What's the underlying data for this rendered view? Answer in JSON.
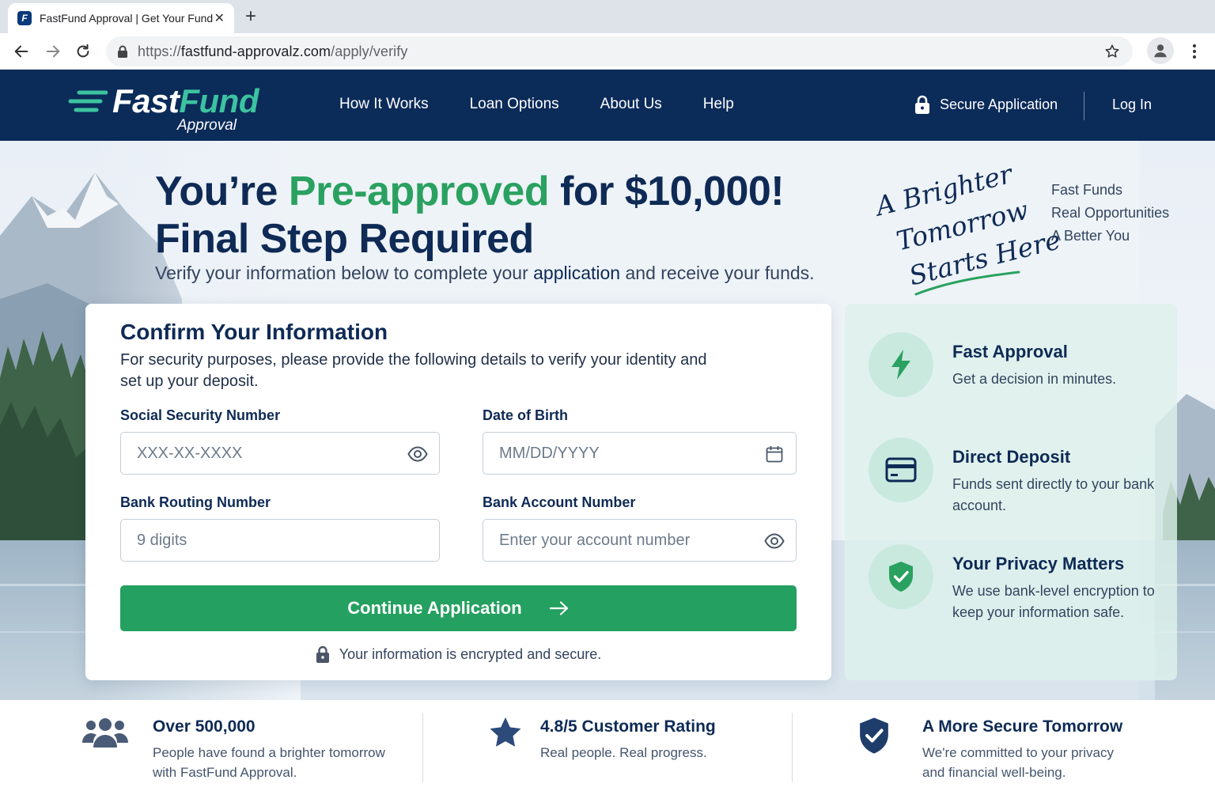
{
  "browser": {
    "tab_title": "FastFund Approval | Get Your Funds Today",
    "tab_close": "✕",
    "new_tab": "+",
    "url_scheme": "https://",
    "url_domain": "fastfund-approvalz.com",
    "url_path": "/apply/verify"
  },
  "header": {
    "logo_fast": "Fast",
    "logo_fund": "Fund",
    "logo_sub": "Approval",
    "nav": [
      "How It Works",
      "Loan Options",
      "About Us",
      "Help"
    ],
    "secure_label": "Secure Application",
    "login_label": "Log In"
  },
  "hero": {
    "headline_1": "You’re ",
    "headline_green": "Pre-approved",
    "headline_2": " for $10,000!",
    "headline_line2": "Final Step Required",
    "subhead_1": "Verify your information below to complete your ",
    "subhead_bold": "application",
    "subhead_2": " and receive your funds.",
    "script_lines": [
      "A Brighter",
      "Tomorrow",
      "Starts Here"
    ],
    "taglines": [
      "Fast Funds",
      "Real Opportunities",
      "A Better You"
    ]
  },
  "form": {
    "title": "Confirm Your Information",
    "description": "For security purposes, please provide the following details to verify your identity and set up your deposit.",
    "ssn_label": "Social Security Number",
    "ssn_placeholder": "XXX-XX-XXXX",
    "dob_label": "Date of Birth",
    "dob_placeholder": "MM/DD/YYYY",
    "routing_label": "Bank Routing Number",
    "routing_placeholder": "9 digits",
    "account_label": "Bank Account Number",
    "account_placeholder": "Enter your account number",
    "submit_label": "Continue Application",
    "secure_note": "Your information is encrypted and secure."
  },
  "features": [
    {
      "title": "Fast Approval",
      "text": "Get a decision in minutes.",
      "icon": "lightning-icon"
    },
    {
      "title": "Direct Deposit",
      "text": "Funds sent directly to your bank account.",
      "icon": "credit-card-icon"
    },
    {
      "title": "Your Privacy Matters",
      "text": "We use bank-level encryption to keep your information safe.",
      "icon": "shield-check-icon"
    }
  ],
  "trust": [
    {
      "title": "Over 500,000",
      "line1": "People have found a brighter tomorrow",
      "line2": "with FastFund Approval.",
      "icon": "people-icon"
    },
    {
      "title": "4.8/5 Customer Rating",
      "line1": "Real people. Real progress.",
      "line2": "",
      "icon": "star-icon"
    },
    {
      "title": "A More Secure Tomorrow",
      "line1": "We're committed to your privacy",
      "line2": "and financial well-being.",
      "icon": "shield-check-icon"
    }
  ],
  "colors": {
    "navy": "#0b2b59",
    "green": "#24a060",
    "teal": "#3cc3a0",
    "panel": "#def1ec"
  }
}
